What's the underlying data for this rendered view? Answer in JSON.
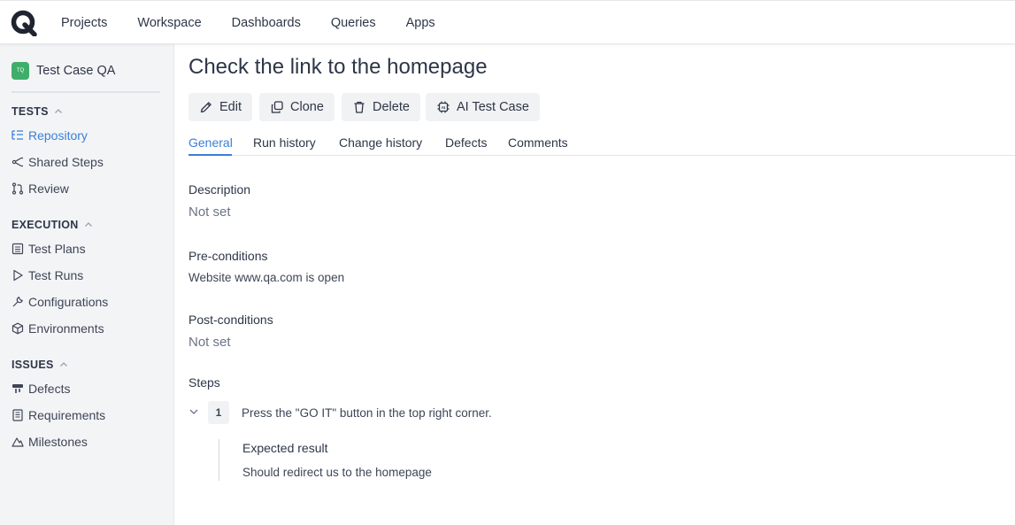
{
  "nav": {
    "items": [
      "Projects",
      "Workspace",
      "Dashboards",
      "Queries",
      "Apps"
    ]
  },
  "project": {
    "avatar_text": "TQ",
    "name": "Test Case QA",
    "avatar_color": "#3fae6a"
  },
  "sidebar": {
    "tests_label": "TESTS",
    "repository": "Repository",
    "shared_steps": "Shared Steps",
    "review": "Review",
    "execution_label": "EXECUTION",
    "test_plans": "Test Plans",
    "test_runs": "Test Runs",
    "configurations": "Configurations",
    "environments": "Environments",
    "issues_label": "ISSUES",
    "defects": "Defects",
    "requirements": "Requirements",
    "milestones": "Milestones"
  },
  "page": {
    "title": "Check the link to the homepage"
  },
  "actions": {
    "edit": "Edit",
    "clone": "Clone",
    "delete": "Delete",
    "ai_test_case": "AI Test Case"
  },
  "tabs": [
    "General",
    "Run history",
    "Change history",
    "Defects",
    "Comments"
  ],
  "fields": {
    "description_label": "Description",
    "description_value": "Not set",
    "preconditions_label": "Pre-conditions",
    "preconditions_value": "Website www.qa.com is open",
    "postconditions_label": "Post-conditions",
    "postconditions_value": "Not set",
    "steps_label": "Steps"
  },
  "steps": [
    {
      "number": "1",
      "action": "Press the \"GO IT\" button in the top right corner.",
      "expected_label": "Expected result",
      "expected": "Should redirect us to the homepage"
    }
  ],
  "colors": {
    "accent": "#3c7fd6",
    "text": "#2d3648",
    "sidebar_bg": "#f3f4f6"
  }
}
